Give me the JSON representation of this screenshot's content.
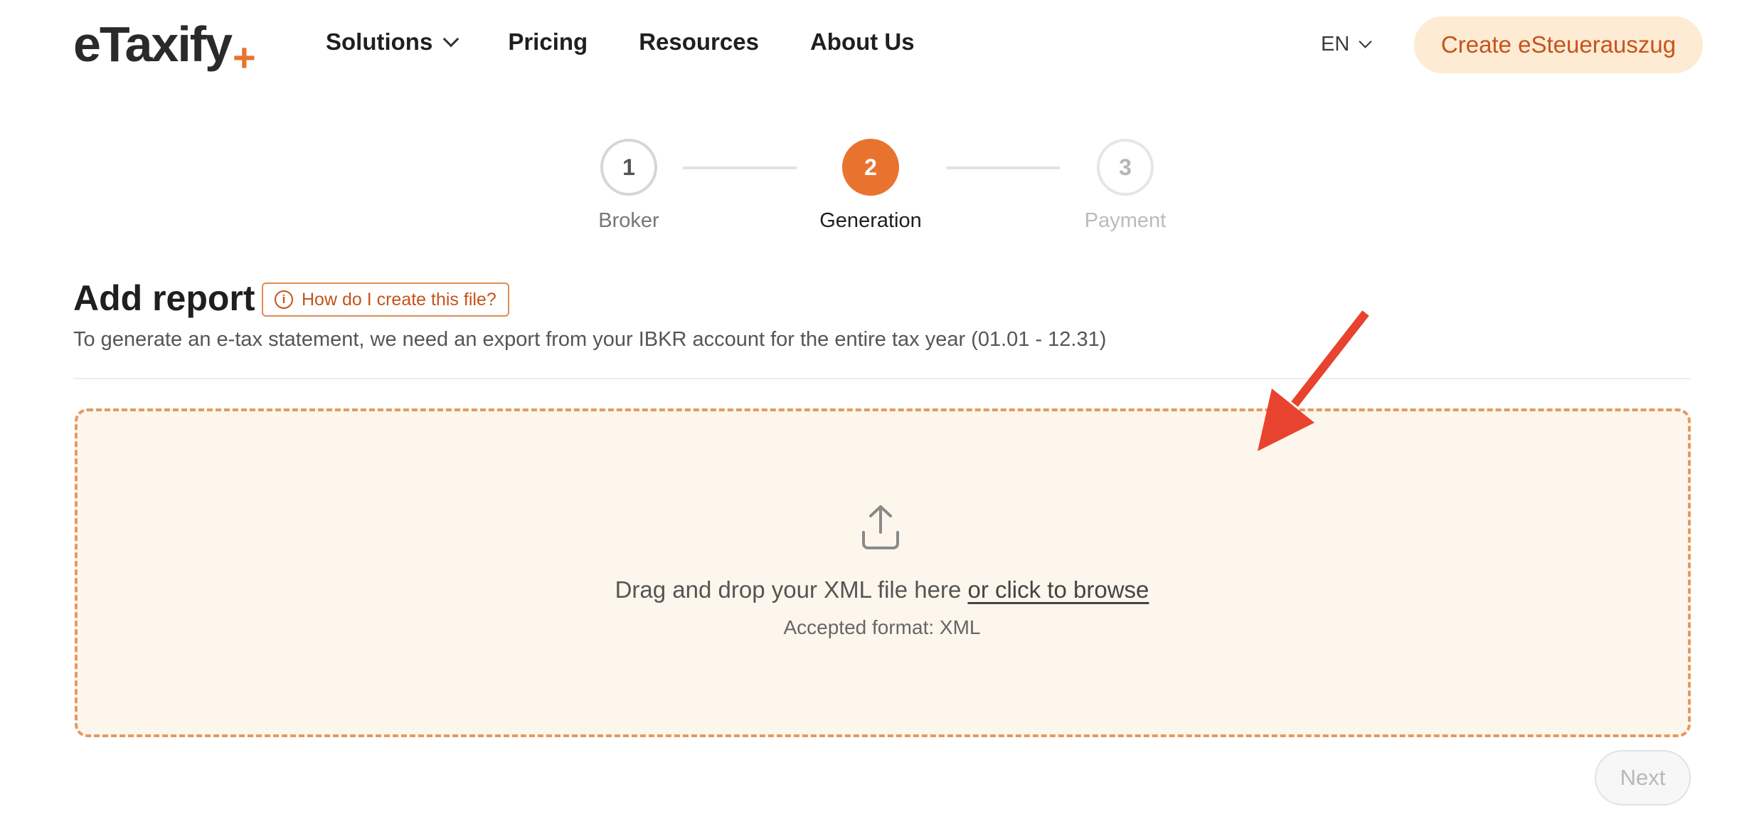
{
  "header": {
    "logo_text": "eTaxify",
    "logo_plus": "+",
    "nav": [
      {
        "label": "Solutions",
        "has_dropdown": true
      },
      {
        "label": "Pricing"
      },
      {
        "label": "Resources"
      },
      {
        "label": "About Us"
      }
    ],
    "language": "EN",
    "cta_label": "Create eSteuerauszug"
  },
  "stepper": {
    "steps": [
      {
        "number": "1",
        "label": "Broker",
        "state": "completed"
      },
      {
        "number": "2",
        "label": "Generation",
        "state": "active"
      },
      {
        "number": "3",
        "label": "Payment",
        "state": "upcoming"
      }
    ]
  },
  "main": {
    "title": "Add report",
    "help_label": "How do I create this file?",
    "subtitle": "To generate an e-tax statement, we need an export from your IBKR account for the entire tax year (01.01 - 12.31)",
    "dropzone": {
      "text": "Drag and drop your XML file here",
      "browse_link": "or click to browse",
      "format_text": "Accepted format: XML"
    },
    "next_label": "Next"
  },
  "colors": {
    "accent": "#e8732f",
    "accent_dark": "#c5541c",
    "cta_bg": "#fdebd3",
    "dropzone_bg": "#fdf6ec",
    "annotation_arrow": "#e8432e"
  },
  "icons": {
    "upload": "upload-icon",
    "info": "info-icon",
    "chevron": "chevron-down-icon",
    "annotation": "red-arrow-annotation"
  }
}
